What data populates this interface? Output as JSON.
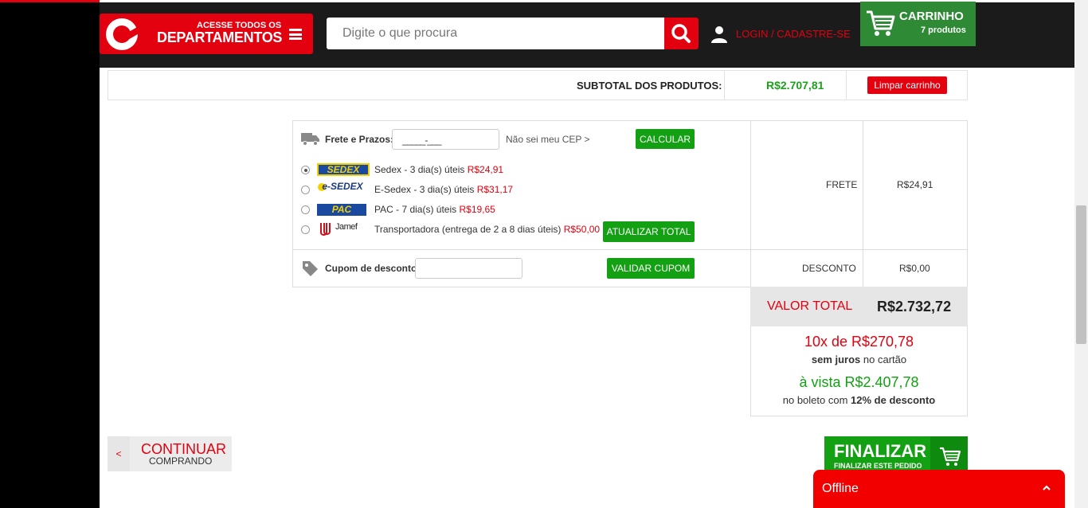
{
  "header": {
    "departments_line1": "ACESSE TODOS OS",
    "departments_line2": "DEPARTAMENTOS",
    "search_placeholder": "Digite o que procura",
    "login_label": "LOGIN / CADASTRE-SE",
    "cart_title": "CARRINHO",
    "cart_count": "7 produtos"
  },
  "subtotal": {
    "label": "SUBTOTAL DOS PRODUTOS:",
    "value": "R$2.707,81",
    "clear_label": "Limpar carrinho"
  },
  "shipping": {
    "label": "Frete e Prazos:",
    "cep_value": "_____-___",
    "unknown_cep": "Não sei meu CEP  >",
    "calc_label": "CALCULAR",
    "options": [
      {
        "logo": "SEDEX",
        "text": "Sedex - 3 dia(s) úteis ",
        "price": "R$24,91",
        "selected": true
      },
      {
        "logo": "e-SEDEX",
        "text": "E-Sedex - 3 dia(s) úteis ",
        "price": "R$31,17",
        "selected": false
      },
      {
        "logo": "PAC",
        "text": "PAC - 7 dia(s) úteis ",
        "price": "R$19,65",
        "selected": false
      },
      {
        "logo": "Jamef",
        "text": "Transportadora (entrega de 2 a 8 dias úteis) ",
        "price": "R$50,00",
        "selected": false
      }
    ],
    "update_label": "ATUALIZAR TOTAL",
    "frete_label": "FRETE",
    "frete_value": "R$24,91"
  },
  "coupon": {
    "label": "Cupom de desconto:",
    "value": "",
    "validate_label": "VALIDAR CUPOM",
    "desconto_label": "DESCONTO",
    "desconto_value": "R$0,00"
  },
  "totals": {
    "total_label": "VALOR TOTAL",
    "total_value": "R$2.732,72",
    "installments": "10x de R$270,78",
    "installments_bold": "sem juros",
    "installments_rest": " no cartão",
    "cash": "à vista R$2.407,78",
    "cash_prefix": "no boleto com ",
    "cash_bold": "12% de desconto"
  },
  "actions": {
    "continue_arrow": "<",
    "continue_line1": "CONTINUAR",
    "continue_line2": "COMPRANDO",
    "finalizar_line1": "FINALIZAR",
    "finalizar_line2": "FINALIZAR ESTE PEDIDO"
  },
  "chat": {
    "status": "Offline"
  },
  "colors": {
    "brand_red": "#e3000f",
    "green": "#13a013"
  }
}
